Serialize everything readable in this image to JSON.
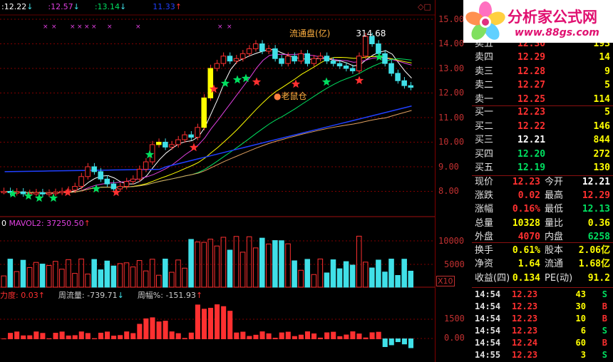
{
  "colors": {
    "up_red": "#ff3030",
    "down_cyan": "#40e0e8",
    "yellow": "#ffff00",
    "white": "#ffffff",
    "green": "#00e060",
    "magenta": "#e040e0",
    "blue": "#2040ff",
    "axis_red": "#c03030"
  },
  "top_header": {
    "items": [
      {
        "text": ":12.22",
        "arrow": "↓",
        "color": "#ffffff"
      },
      {
        "text": ":12.57",
        "arrow": "↓",
        "color": "#e040e0"
      },
      {
        "text": ":13.14",
        "arrow": "↓",
        "color": "#00e060"
      },
      {
        "text": "11.33",
        "arrow": "↑",
        "color": "#2040ff"
      }
    ],
    "symbols": "◇□"
  },
  "main_chart": {
    "annotation_liutong": "流通盘(亿)",
    "annotation_value": "314.68",
    "annotation_laoshucang": "老鼠仓",
    "y_ticks": [
      "15.00",
      "14.00",
      "13.00",
      "12.00",
      "11.00",
      "10.00",
      "9.00",
      "8.00"
    ]
  },
  "volume_panel": {
    "label": "MAVOL2: 37250.50",
    "label_arrow": "↑",
    "y_ticks": [
      "10000",
      "5000"
    ],
    "x10": "X10"
  },
  "flow_panel": {
    "labels": [
      {
        "text": "力度: 0.03",
        "arrow": "↑"
      },
      {
        "text": "周流量: -739.71",
        "arrow": "↓"
      },
      {
        "text": "周幅%: -151.93",
        "arrow": "↑"
      }
    ],
    "y_ticks": [
      "1500",
      "0.00"
    ]
  },
  "logo": {
    "title": "分析家公式网",
    "url": "www.88gs.com"
  },
  "order_book": {
    "asks": [
      {
        "label": "卖五",
        "price": "12.30",
        "volume": "193"
      },
      {
        "label": "卖四",
        "price": "12.29",
        "volume": "14"
      },
      {
        "label": "卖三",
        "price": "12.28",
        "volume": "9"
      },
      {
        "label": "卖二",
        "price": "12.27",
        "volume": "5"
      },
      {
        "label": "卖一",
        "price": "12.25",
        "volume": "114"
      }
    ],
    "bids": [
      {
        "label": "买一",
        "price": "12.23",
        "volume": "5"
      },
      {
        "label": "买二",
        "price": "12.22",
        "volume": "146"
      },
      {
        "label": "买三",
        "price": "12.21",
        "volume": "844"
      },
      {
        "label": "买四",
        "price": "12.20",
        "volume": "272"
      },
      {
        "label": "买五",
        "price": "12.19",
        "volume": "130"
      }
    ]
  },
  "quote": [
    {
      "l1": "现价",
      "v1": "12.23",
      "l2": "今开",
      "v2": "12.21"
    },
    {
      "l1": "涨跌",
      "v1": "0.02",
      "l2": "最高",
      "v2": "12.29"
    },
    {
      "l1": "涨幅",
      "v1": "0.16%",
      "l2": "最低",
      "v2": "12.13"
    },
    {
      "l1": "总量",
      "v1": "10328",
      "l2": "量比",
      "v2": "0.36"
    },
    {
      "l1": "外盘",
      "v1": "4070",
      "l2": "内盘",
      "v2": "6258"
    }
  ],
  "stats": [
    {
      "l1": "换手",
      "v1": "0.61%",
      "l2": "股本",
      "v2": "2.06亿"
    },
    {
      "l1": "净资",
      "v1": "1.64",
      "l2": "流通",
      "v2": "1.68亿"
    },
    {
      "l1": "收益(四)",
      "v1": "0.134",
      "l2": "PE(动)",
      "v2": "91.2"
    }
  ],
  "ticks": [
    {
      "time": "14:54",
      "price": "12.23",
      "vol": "43",
      "side": "S"
    },
    {
      "time": "14:54",
      "price": "12.23",
      "vol": "30",
      "side": "B"
    },
    {
      "time": "14:54",
      "price": "12.23",
      "vol": "10",
      "side": "B"
    },
    {
      "time": "14:54",
      "price": "12.23",
      "vol": "6",
      "side": "S"
    },
    {
      "time": "14:54",
      "price": "12.24",
      "vol": "60",
      "side": "B"
    },
    {
      "time": "14:55",
      "price": "12.23",
      "vol": "3",
      "side": "S"
    }
  ]
}
